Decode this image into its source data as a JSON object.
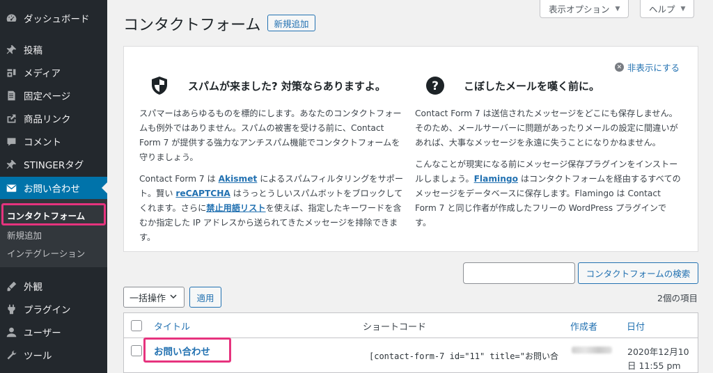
{
  "sidebar": {
    "items": [
      {
        "label": "ダッシュボード",
        "icon": "dashboard-icon"
      },
      {
        "label": "投稿",
        "icon": "pin-icon"
      },
      {
        "label": "メディア",
        "icon": "media-icon"
      },
      {
        "label": "固定ページ",
        "icon": "page-icon"
      },
      {
        "label": "商品リンク",
        "icon": "link-icon"
      },
      {
        "label": "コメント",
        "icon": "comment-icon"
      },
      {
        "label": "STINGERタグ",
        "icon": "pin-icon"
      },
      {
        "label": "お問い合わせ",
        "icon": "mail-icon"
      }
    ],
    "submenu": {
      "current": "コンタクトフォーム",
      "add_new": "新規追加",
      "integration": "インテグレーション"
    },
    "lower_items": [
      {
        "label": "外観",
        "icon": "appearance-icon"
      },
      {
        "label": "プラグイン",
        "icon": "plugin-icon"
      },
      {
        "label": "ユーザー",
        "icon": "user-icon"
      },
      {
        "label": "ツール",
        "icon": "tool-icon"
      }
    ],
    "accent_color": "#0073aa",
    "highlight_color": "#e6337e"
  },
  "header": {
    "title": "コンタクトフォーム",
    "add_new": "新規追加",
    "screen_options": "表示オプション",
    "help": "ヘルプ"
  },
  "welcome": {
    "dismiss": "非表示にする",
    "left": {
      "title": "スパムが来ました? 対策ならありますよ。",
      "p1": "スパマーはあらゆるものを標的にします。あなたのコンタクトフォームも例外ではありません。スパムの被害を受ける前に、Contact Form 7 が提供する強力なアンチスパム機能でコンタクトフォームを守りましょう。",
      "p2_a": "Contact Form 7 は ",
      "p2_link1": "Akismet",
      "p2_b": " によるスパムフィルタリングをサポート。賢い ",
      "p2_link2": "reCAPTCHA",
      "p2_c": " はうっとうしいスパムボットをブロックしてくれます。さらに",
      "p2_link3": "禁止用語リスト",
      "p2_d": "を使えば、指定したキーワードを含むか指定した IP アドレスから送られてきたメッセージを排除できます。"
    },
    "right": {
      "title": "こぼしたメールを嘆く前に。",
      "p1": "Contact Form 7 は送信されたメッセージをどこにも保存しません。そのため、メールサーバーに問題があったりメールの設定に間違いがあれば、大事なメッセージを永遠に失うことになりかねません。",
      "p2_a": "こんなことが現実になる前にメッセージ保存プラグインをインストールしましょう。",
      "p2_link": "Flamingo",
      "p2_b": " はコンタクトフォームを経由するすべてのメッセージをデータベースに保存します。Flamingo は Contact Form 7 と同じ作者が作成したフリーの WordPress プラグインです。"
    }
  },
  "search": {
    "value": "",
    "button": "コンタクトフォームの検索"
  },
  "bulk": {
    "select": "一括操作",
    "apply": "適用",
    "count": "2個の項目"
  },
  "table": {
    "headers": {
      "title": "タイトル",
      "shortcode": "ショートコード",
      "author": "作成者",
      "date": "日付"
    },
    "rows": [
      {
        "title": "お問い合わせ",
        "shortcode": "[contact-form-7 id=\"11\" title=\"お問い合",
        "date_line1": "2020年12月10",
        "date_line2": "日 11:55 pm"
      }
    ]
  }
}
